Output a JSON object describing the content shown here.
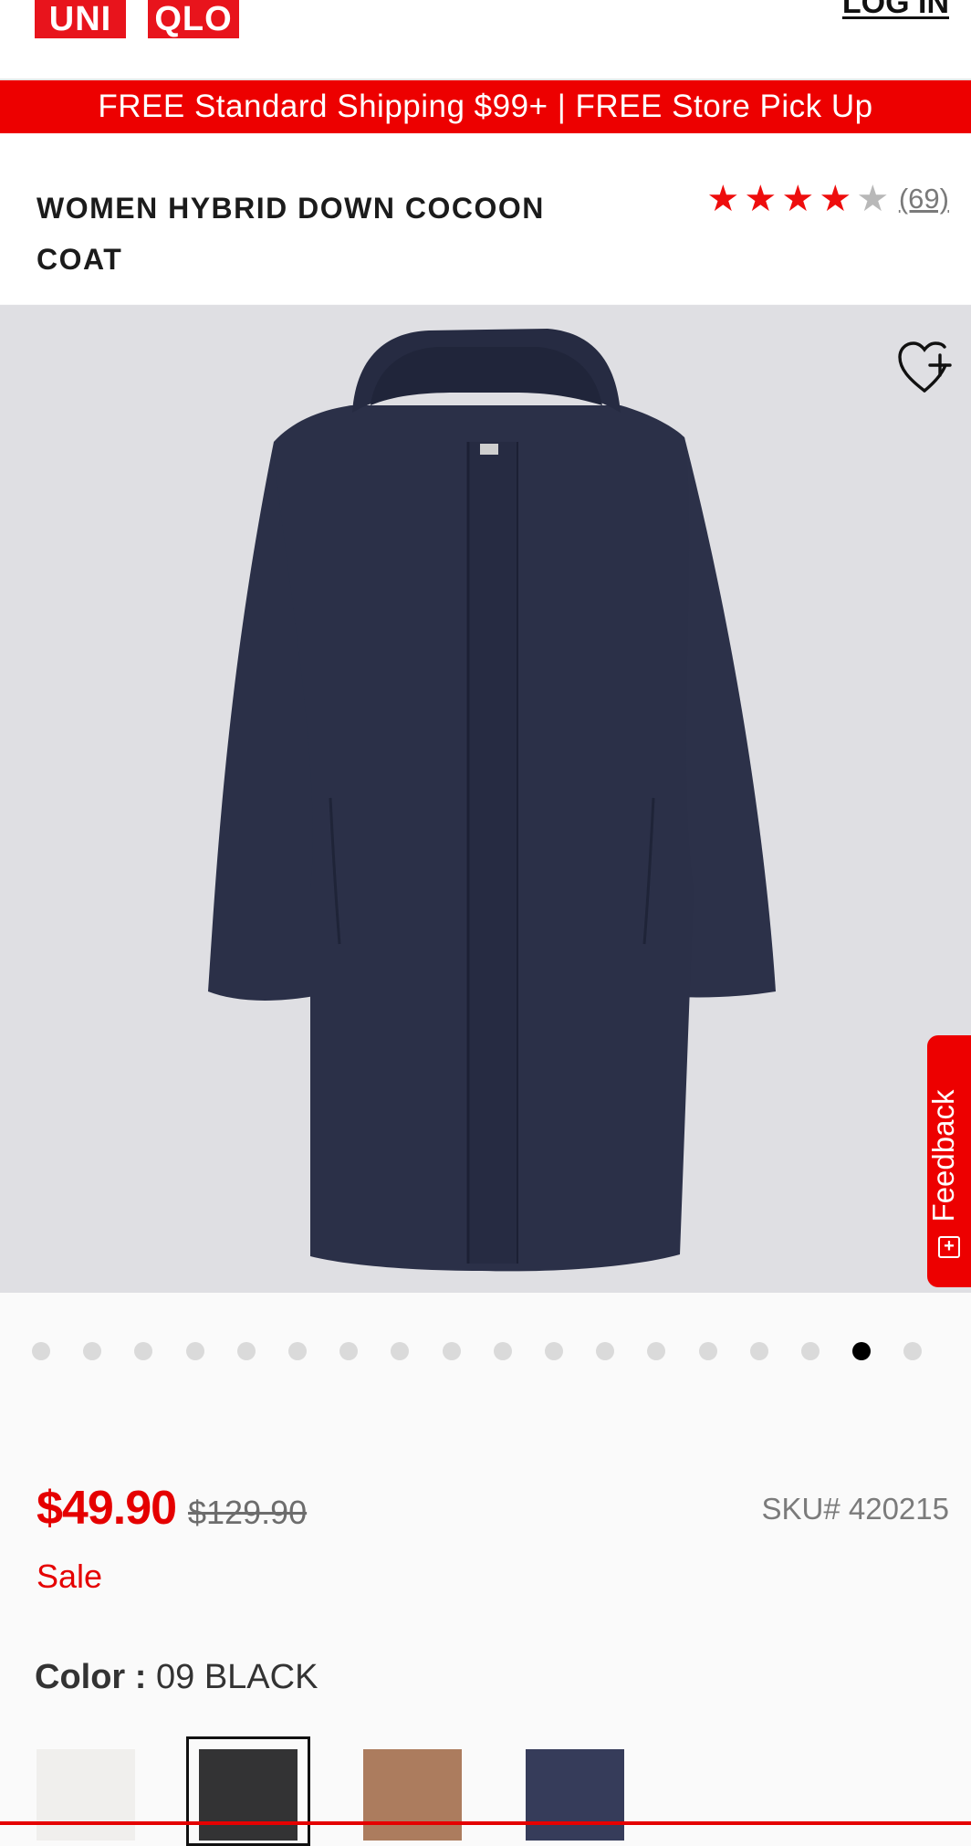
{
  "header": {
    "logo_left": "UNI",
    "logo_right": "QLO",
    "login_label": "LOG IN",
    "brand_color": "#e8141c"
  },
  "promo": {
    "text": "FREE Standard Shipping $99+ | FREE Store Pick Up"
  },
  "product": {
    "title": "WOMEN HYBRID DOWN COCOON COAT",
    "rating": 4.5,
    "rating_max": 5,
    "review_count": "(69)",
    "price": "$49.90",
    "original_price": "$129.90",
    "badge": "Sale",
    "sku": "SKU# 420215"
  },
  "gallery": {
    "image_icon": "coat-photo",
    "wishlist_icon": "heart-plus-icon",
    "dot_count": 18,
    "active_dot_index": 16
  },
  "feedback": {
    "label": "Feedback",
    "icon": "plus-box-icon",
    "icon_glyph": "+"
  },
  "color": {
    "label": "Color :",
    "value": "09 BLACK",
    "swatches": [
      {
        "name": "off-white",
        "hex": "#f0efed"
      },
      {
        "name": "black",
        "hex": "#333334"
      },
      {
        "name": "brown",
        "hex": "#ac7c5e"
      },
      {
        "name": "navy",
        "hex": "#363c5a"
      }
    ],
    "selected_index": 1
  },
  "colors": {
    "accent": "#ed0000",
    "price": "#e50000",
    "star_filled": "#ee0d0d",
    "star_empty": "#b8b8b8"
  }
}
